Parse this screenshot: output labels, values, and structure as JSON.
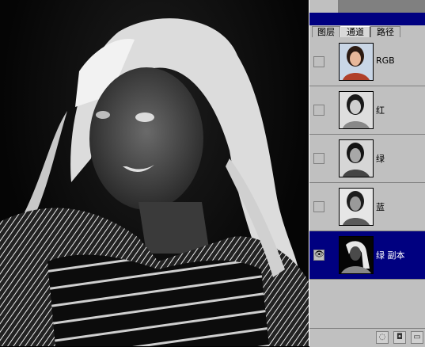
{
  "palette": {
    "tabs": [
      {
        "label": "图层",
        "active": false
      },
      {
        "label": "通道",
        "active": true
      },
      {
        "label": "路径",
        "active": false
      }
    ],
    "channels": [
      {
        "name": "RGB",
        "visible": false,
        "selected": false,
        "thumb": "color-portrait"
      },
      {
        "name": "红",
        "visible": false,
        "selected": false,
        "thumb": "gray-portrait"
      },
      {
        "name": "绿",
        "visible": false,
        "selected": false,
        "thumb": "gray-portrait"
      },
      {
        "name": "蓝",
        "visible": false,
        "selected": false,
        "thumb": "gray-portrait"
      },
      {
        "name": "绿 副本",
        "visible": true,
        "selected": true,
        "thumb": "inverted-portrait"
      }
    ],
    "eye_glyph": "👁",
    "bottom_buttons": [
      "load-selection-icon",
      "save-selection-icon",
      "new-channel-icon"
    ]
  },
  "colors": {
    "title_bar": "#000080",
    "panel": "#c0c0c0",
    "selected_row": "#000080"
  }
}
